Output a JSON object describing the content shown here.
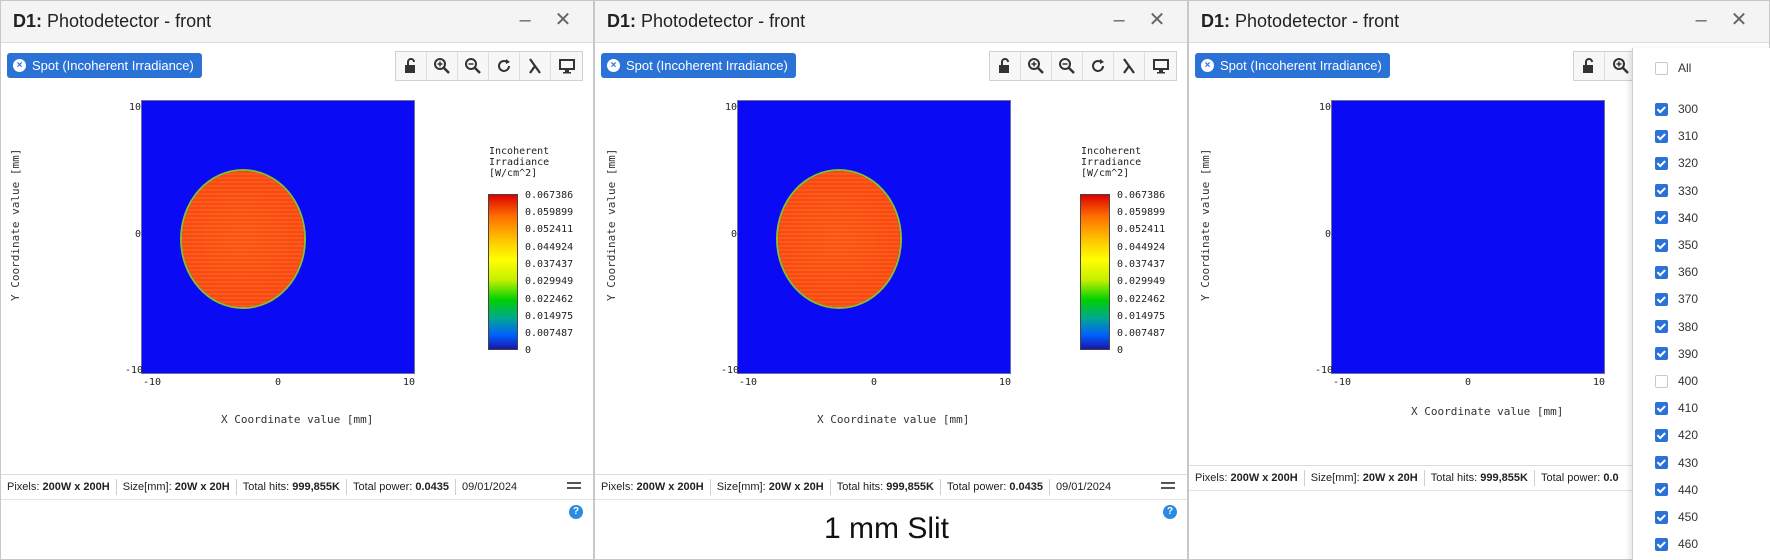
{
  "panels": [
    {
      "title_prefix": "D1:",
      "title": "Photodetector - front",
      "minimize": "–",
      "close": "✕",
      "spot_button": "Spot (Incoherent Irradiance)",
      "xlabel": "X Coordinate value [mm]",
      "ylabel": "Y Coordinate value [mm]",
      "xticks": [
        "-10",
        "0",
        "10"
      ],
      "yticks": [
        "10",
        "0",
        "-10"
      ],
      "spot_visible": true,
      "colorbar_title": [
        "Incoherent",
        "Irradiance",
        "[W/cm^2]"
      ],
      "colorbar_ticks": [
        "0.067386",
        "0.059899",
        "0.052411",
        "0.044924",
        "0.037437",
        "0.029949",
        "0.022462",
        "0.014975",
        "0.007487",
        "0"
      ],
      "status": {
        "pixels_label": "Pixels:",
        "pixels_value": "200W x 200H",
        "size_label": "Size[mm]:",
        "size_value": "20W x 20H",
        "hits_label": "Total hits:",
        "hits_value": "999,855K",
        "power_label": "Total power:",
        "power_value": "0.0435",
        "date": "09/01/2024"
      }
    },
    {
      "title_prefix": "D1:",
      "title": "Photodetector - front",
      "minimize": "–",
      "close": "✕",
      "spot_button": "Spot (Incoherent Irradiance)",
      "xlabel": "X Coordinate value [mm]",
      "ylabel": "Y Coordinate value [mm]",
      "xticks": [
        "-10",
        "0",
        "10"
      ],
      "yticks": [
        "10",
        "0",
        "-10"
      ],
      "spot_visible": true,
      "colorbar_title": [
        "Incoherent",
        "Irradiance",
        "[W/cm^2]"
      ],
      "colorbar_ticks": [
        "0.067386",
        "0.059899",
        "0.052411",
        "0.044924",
        "0.037437",
        "0.029949",
        "0.022462",
        "0.014975",
        "0.007487",
        "0"
      ],
      "status": {
        "pixels_label": "Pixels:",
        "pixels_value": "200W x 200H",
        "size_label": "Size[mm]:",
        "size_value": "20W x 20H",
        "hits_label": "Total hits:",
        "hits_value": "999,855K",
        "power_label": "Total power:",
        "power_value": "0.0435",
        "date": "09/01/2024"
      }
    },
    {
      "title_prefix": "D1:",
      "title": "Photodetector - front",
      "minimize": "–",
      "close": "✕",
      "spot_button": "Spot (Incoherent Irradiance)",
      "xlabel": "X Coordinate value [mm]",
      "ylabel": "Y Coordinate value [mm]",
      "xticks": [
        "-10",
        "0",
        "10"
      ],
      "yticks": [
        "10",
        "0",
        "-10"
      ],
      "spot_visible": false,
      "status": {
        "pixels_label": "Pixels:",
        "pixels_value": "200W x 200H",
        "size_label": "Size[mm]:",
        "size_value": "20W x 20H",
        "hits_label": "Total hits:",
        "hits_value": "999,855K",
        "power_label": "Total power:",
        "power_value": "0.0",
        "date": ""
      }
    }
  ],
  "toolbar_icons": [
    "lock-open-icon",
    "zoom-in-icon",
    "zoom-out-icon",
    "refresh-icon",
    "lambda-icon",
    "monitor-icon"
  ],
  "caption": "1 mm Slit",
  "wavelength_filter": {
    "all_label": "All",
    "all_checked": false,
    "items": [
      {
        "label": "300",
        "checked": true
      },
      {
        "label": "310",
        "checked": true
      },
      {
        "label": "320",
        "checked": true
      },
      {
        "label": "330",
        "checked": true
      },
      {
        "label": "340",
        "checked": true
      },
      {
        "label": "350",
        "checked": true
      },
      {
        "label": "360",
        "checked": true
      },
      {
        "label": "370",
        "checked": true
      },
      {
        "label": "380",
        "checked": true
      },
      {
        "label": "390",
        "checked": true
      },
      {
        "label": "400",
        "checked": false
      },
      {
        "label": "410",
        "checked": true
      },
      {
        "label": "420",
        "checked": true
      },
      {
        "label": "430",
        "checked": true
      },
      {
        "label": "440",
        "checked": true
      },
      {
        "label": "450",
        "checked": true
      },
      {
        "label": "460",
        "checked": true
      }
    ]
  },
  "colors": {
    "accent": "#2a72d6",
    "detector_background": "#0a0af4",
    "spot": "#ff4d10"
  }
}
